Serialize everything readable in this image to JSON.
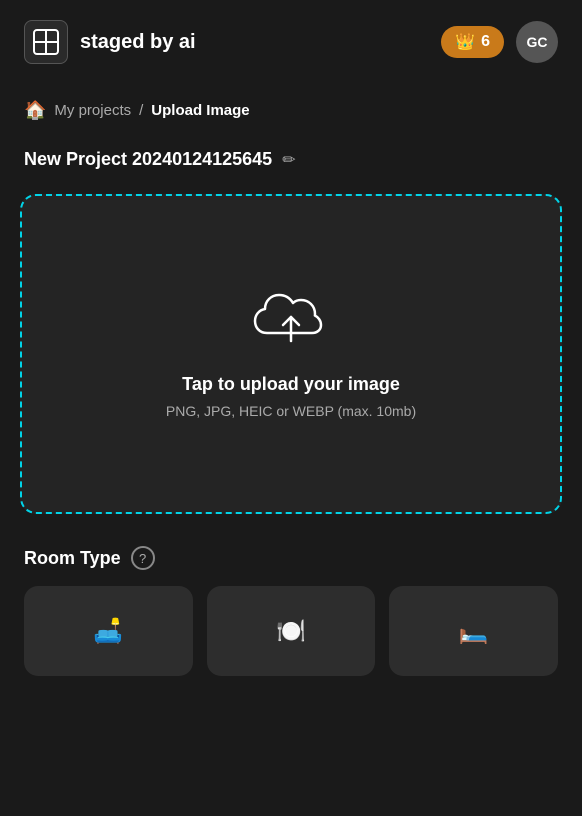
{
  "header": {
    "logo_text": "staged\nby ai",
    "credits_count": "6",
    "avatar_initials": "GC"
  },
  "breadcrumb": {
    "home_icon": "🏠",
    "separator": "/",
    "parent": "My projects",
    "current": "Upload Image"
  },
  "project": {
    "title": "New Project 20240124125645",
    "edit_icon": "✏"
  },
  "upload": {
    "title": "Tap to upload your image",
    "subtitle": "PNG, JPG, HEIC or WEBP (max. 10mb)"
  },
  "room_type": {
    "label": "Room Type",
    "help_icon": "?"
  },
  "room_cards": [
    {
      "icon": "🛋"
    },
    {
      "icon": "🍽"
    },
    {
      "icon": "🛏"
    }
  ],
  "colors": {
    "accent": "#00d4e8",
    "background": "#1a1a1a",
    "card_bg": "#2d2d2d",
    "credits_bg": "#c97a1a"
  }
}
